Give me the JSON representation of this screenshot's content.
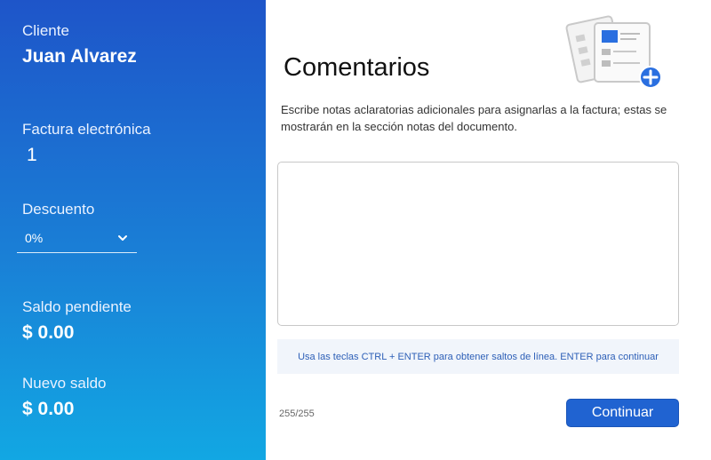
{
  "sidebar": {
    "client_label": "Cliente",
    "client_name": "Juan Alvarez",
    "invoice_label": "Factura electrónica",
    "invoice_number": "1",
    "discount_label": "Descuento",
    "discount_value": "0%",
    "pending_balance_label": "Saldo pendiente",
    "pending_balance_value": "$ 0.00",
    "new_balance_label": "Nuevo saldo",
    "new_balance_value": "$ 0.00"
  },
  "main": {
    "title": "Comentarios",
    "description": "Escribe notas aclaratorias adicionales para asignarlas a la factura; estas se mostrarán en la sección notas del documento.",
    "comment_value": "",
    "hint": "Usa las teclas CTRL + ENTER para obtener saltos de línea. ENTER para continuar",
    "counter": "255/255",
    "continue_label": "Continuar"
  },
  "colors": {
    "sidebar_top": "#1e55c9",
    "sidebar_bottom": "#12a7e3",
    "primary_button": "#2063d1",
    "hint_text": "#2d5fb7",
    "hint_background": "#f1f5fb"
  },
  "icons": {
    "discount_dropdown": "chevron-down-icon",
    "illustration": "documents-add-icon"
  }
}
